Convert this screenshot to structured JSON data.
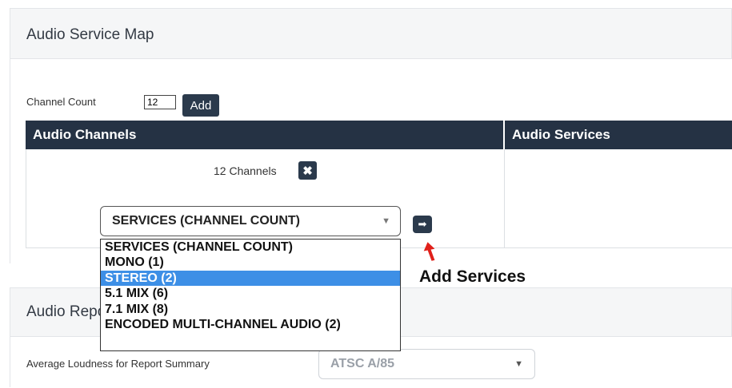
{
  "audio_service_map": {
    "title": "Audio Service Map",
    "channel_count_label": "Channel Count",
    "channel_count_value": "12",
    "add_label": "Add",
    "columns": {
      "channels": "Audio Channels",
      "services": "Audio Services"
    },
    "channels_summary": "12 Channels",
    "remove_icon": "close-icon",
    "services_select": {
      "selected": "SERVICES (CHANNEL COUNT)"
    },
    "add_services_icon": "arrow-right-icon"
  },
  "dropdown": {
    "options": [
      "SERVICES (CHANNEL COUNT)",
      "MONO (1)",
      "STEREO (2)",
      "5.1 MIX (6)",
      "7.1 MIX (8)",
      "ENCODED MULTI-CHANNEL AUDIO (2)"
    ],
    "highlighted": "STEREO (2)"
  },
  "annotation": {
    "text": "Add Services",
    "arrow_color": "#e0201a"
  },
  "audio_report": {
    "title": "Audio Report",
    "loudness_label": "Average Loudness for Report Summary",
    "loudness_value": "ATSC A/85"
  },
  "colors": {
    "header_bg": "#253244",
    "button_bg": "#2b3a4c",
    "highlight": "#3d8fe6",
    "panel_bg": "#f5f6f7"
  }
}
